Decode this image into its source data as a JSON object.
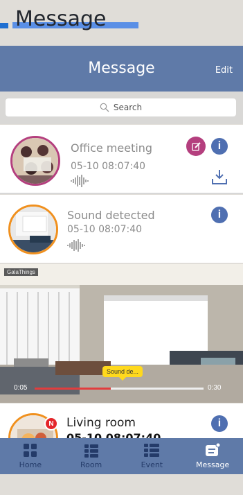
{
  "top_banner": {
    "title": "Message"
  },
  "header": {
    "title": "Message",
    "edit_label": "Edit"
  },
  "search": {
    "label": "Search"
  },
  "messages": [
    {
      "title": "Office meeting",
      "time": "05-10 08:07:40"
    },
    {
      "title": "Sound detected",
      "time": "05-10 08:07:40"
    }
  ],
  "video": {
    "watermark": "GalaThings",
    "start_time": "0:05",
    "end_time": "0:30",
    "event_label": "Sound de..."
  },
  "third_message": {
    "title": "Living room",
    "time": "05-10 08:07:40",
    "badge": "N"
  },
  "tabs": [
    {
      "label": "Home",
      "icon": "home-icon"
    },
    {
      "label": "Room",
      "icon": "room-icon"
    },
    {
      "label": "Event",
      "icon": "event-icon"
    },
    {
      "label": "Message",
      "icon": "message-icon"
    }
  ],
  "colors": {
    "header": "#5f7aa8",
    "accent_pink": "#b43f7e",
    "accent_orange": "#f0901e",
    "info_blue": "#4f6fb1",
    "progress": "#e23d3d",
    "marker": "#ffd91d"
  }
}
